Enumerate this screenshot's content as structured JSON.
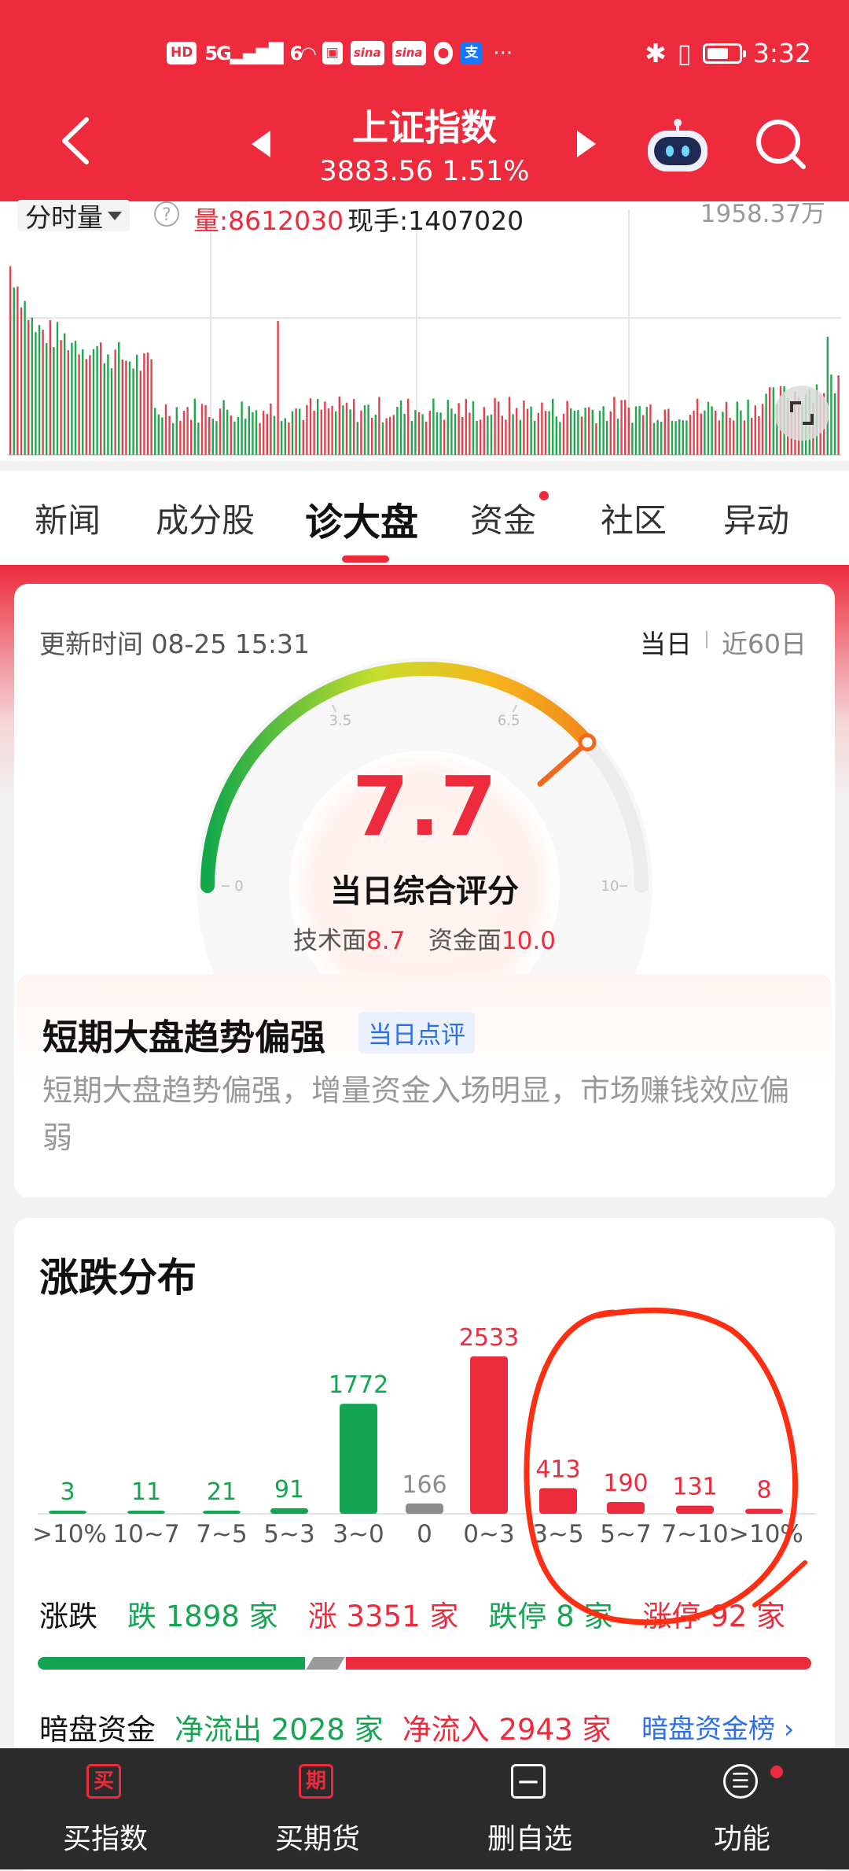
{
  "status_bar": {
    "left_chips": [
      "HD",
      "sina",
      "sina"
    ],
    "network": "5G",
    "wifi_label": "6",
    "more": "···",
    "time": "3:32"
  },
  "header": {
    "title": "上证指数",
    "subtitle": "3883.56 1.51%"
  },
  "volume_chart": {
    "mode_label": "分时量",
    "help": "?",
    "amount": "量:8612030",
    "hand": "现手:1407020",
    "max_value": "1958.37万"
  },
  "tabs": [
    {
      "label": "新闻"
    },
    {
      "label": "成分股"
    },
    {
      "label": "诊大盘"
    },
    {
      "label": "资金"
    },
    {
      "label": "社区"
    },
    {
      "label": "异动"
    }
  ],
  "score_card": {
    "update_time": "更新时间 08-25 15:31",
    "range_day": "当日",
    "range_60": "近60日",
    "score": "7.7",
    "score_fraction": 0.77,
    "score_label": "当日综合评分",
    "tech_label": "技术面",
    "tech_value": "8.7",
    "fund_label": "资金面",
    "fund_value": "10.0",
    "gauge_ticks": [
      "0",
      "3.5",
      "6.5",
      "10"
    ],
    "trend_title": "短期大盘趋势偏强",
    "trend_tag": "当日点评",
    "trend_text": "短期大盘趋势偏强，增量资金入场明显，市场赚钱效应偏弱"
  },
  "distribution": {
    "title": "涨跌分布",
    "summary_label": "涨跌",
    "down": "跌 1898 家",
    "up": "涨 3351 家",
    "limit_down": "跌停 8 家",
    "limit_up": "涨停 92 家",
    "dark_label": "暗盘资金",
    "net_out": "净流出 2028 家",
    "net_in": "净流入 2943 家",
    "dark_link": "暗盘资金榜 ›"
  },
  "chart_data": {
    "type": "bar",
    "categories": [
      ">10%",
      "10~7",
      "7~5",
      "5~3",
      "3~0",
      "0",
      "0~3",
      "3~5",
      "5~7",
      "7~10",
      ">10%"
    ],
    "values": [
      3,
      11,
      21,
      91,
      1772,
      166,
      2533,
      413,
      190,
      131,
      81
    ],
    "value_labels": [
      "3",
      "11",
      "21",
      "91",
      "1772",
      "166",
      "2533",
      "413",
      "190",
      "131",
      "8"
    ],
    "colors": [
      "#14a552",
      "#14a552",
      "#14a552",
      "#14a552",
      "#14a552",
      "#8c8c8c",
      "#ee2a3d",
      "#ee2a3d",
      "#ee2a3d",
      "#ee2a3d",
      "#ee2a3d"
    ],
    "title": "涨跌分布"
  },
  "bottom_bar": [
    {
      "label": "买指数",
      "icon": "买"
    },
    {
      "label": "买期货",
      "icon": "期"
    },
    {
      "label": "删自选",
      "icon": "—"
    },
    {
      "label": "功能",
      "icon": "☰"
    }
  ],
  "colors": {
    "red": "#ee2a3d",
    "green": "#14a552",
    "blue": "#2e6fe6"
  }
}
